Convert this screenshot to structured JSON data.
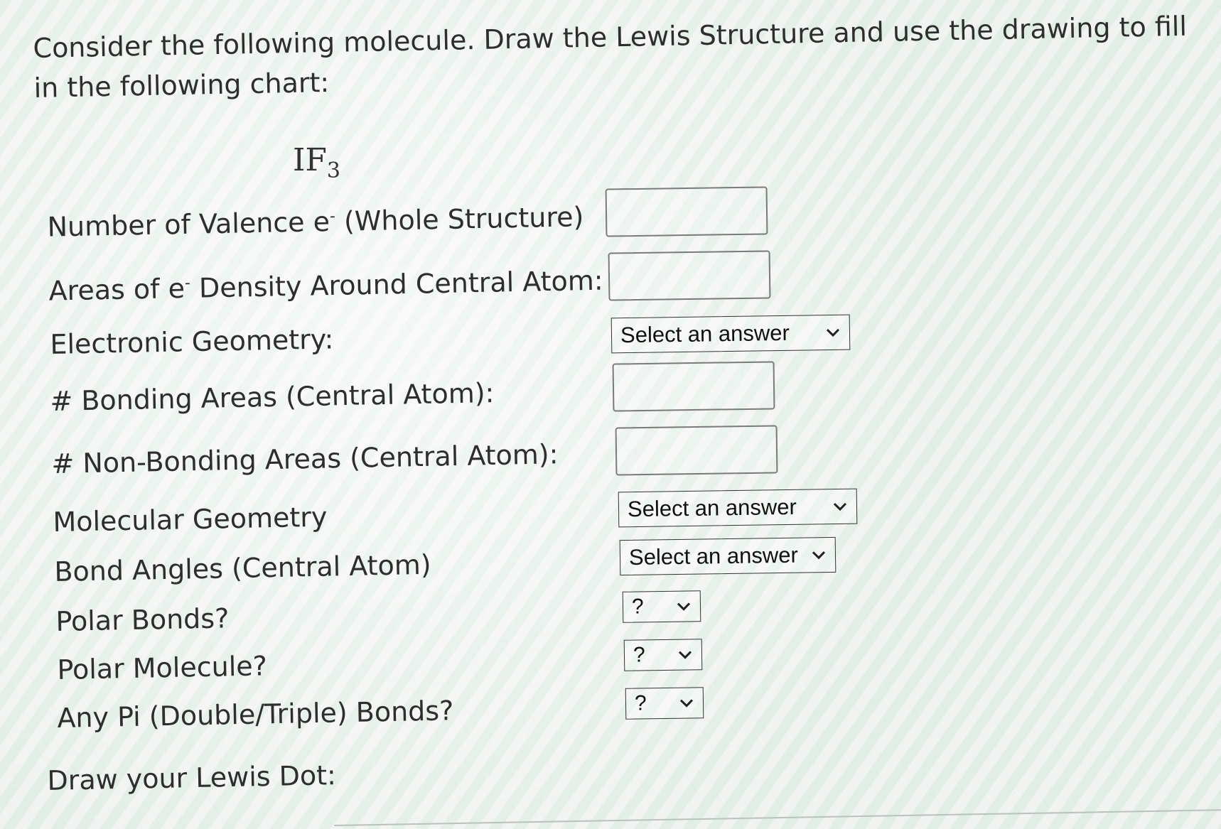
{
  "intro": "Consider the following molecule. Draw the Lewis Structure and use the drawing to fill in the following chart:",
  "formula": {
    "base": "IF",
    "subscript": "3"
  },
  "rows": {
    "valence": {
      "label_a": "Number of Valence e",
      "sup": "-",
      "label_b": " (Whole Structure)",
      "value": ""
    },
    "density": {
      "label_a": "Areas of e",
      "sup": "-",
      "label_b": " Density Around Central Atom:",
      "value": ""
    },
    "electronic_geometry": {
      "label": "Electronic Geometry:",
      "selected": "Select an answer"
    },
    "bonding": {
      "label": "# Bonding Areas (Central Atom):",
      "value": ""
    },
    "nonbonding": {
      "label": "# Non-Bonding Areas (Central Atom):",
      "value": ""
    },
    "molecular_geometry": {
      "label": "Molecular Geometry",
      "selected": "Select an answer"
    },
    "bond_angles": {
      "label": "Bond Angles (Central Atom)",
      "selected": "Select an answer"
    },
    "polar_bonds": {
      "label": "Polar Bonds?",
      "selected": "?"
    },
    "polar_molecule": {
      "label": "Polar Molecule?",
      "selected": "?"
    },
    "pi_bonds": {
      "label": "Any Pi (Double/Triple) Bonds?",
      "selected": "?"
    }
  },
  "draw_label": "Draw your Lewis Dot:",
  "icons": {
    "dropdown": "chevron-down-icon"
  }
}
